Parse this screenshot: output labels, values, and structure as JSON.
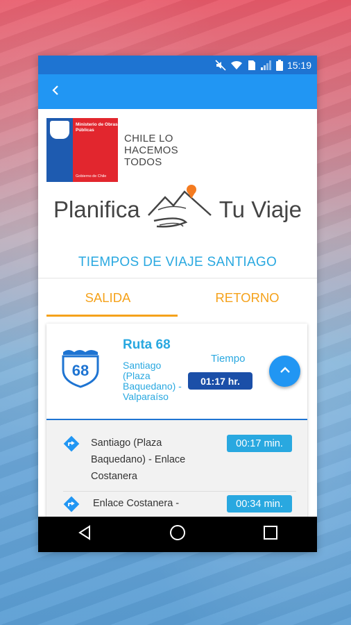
{
  "status_bar": {
    "time": "15:19"
  },
  "header": {
    "logo_text_1": "Ministerio de Obras Públicas",
    "logo_text_2": "Gobierno de Chile",
    "slogan": "CHILE LO HACEMOS TODOS",
    "slogan_lines": [
      "CHILE LO",
      "HACEMOS",
      "TODOS"
    ]
  },
  "banner": {
    "left": "Planifica",
    "right": "Tu Viaje"
  },
  "section": {
    "title": "TIEMPOS DE VIAJE SANTIAGO"
  },
  "tabs": [
    {
      "label": "SALIDA",
      "active": true
    },
    {
      "label": "RETORNO",
      "active": false
    }
  ],
  "route": {
    "number": "68",
    "name": "Ruta 68",
    "description": "Santiago (Plaza Baquedano) - Valparaíso",
    "time_label": "Tiempo",
    "time_value": "01:17 hr."
  },
  "segments": [
    {
      "name": "Santiago (Plaza Baquedano) - Enlace Costanera",
      "time": "00:17 min."
    },
    {
      "name": "Enlace Costanera -",
      "time": "00:34 min."
    }
  ],
  "colors": {
    "accent": "#29a8e0",
    "primary": "#2196f3",
    "tab": "#f5a21b",
    "badge_dark": "#1b4fa8"
  },
  "icons": [
    "back-arrow-icon",
    "mute-icon",
    "wifi-icon",
    "battery-icon",
    "expand-less-icon",
    "direction-icon",
    "nav-back-icon",
    "nav-home-icon",
    "nav-recents-icon"
  ]
}
